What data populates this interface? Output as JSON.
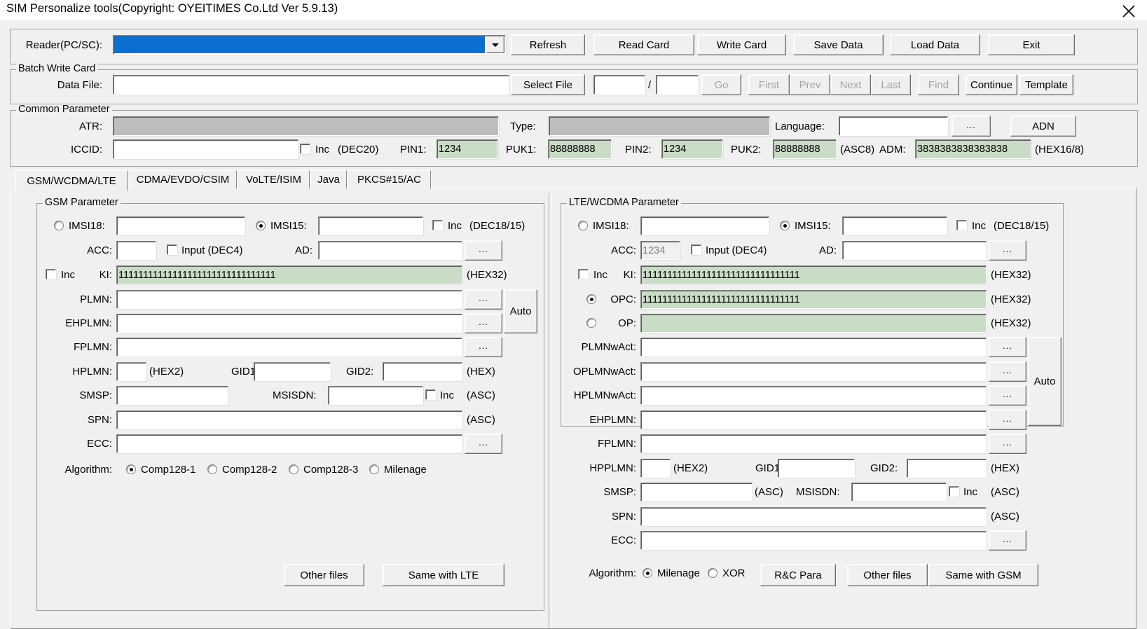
{
  "window": {
    "title": "SIM Personalize tools(Copyright: OYEITIMES Co.Ltd  Ver 5.9.13)",
    "close_icon": "close-icon"
  },
  "toolbar": {
    "reader_label": "Reader(PC/SC):",
    "reader_value": "",
    "buttons": [
      {
        "label": "Refresh"
      },
      {
        "label": "Read Card"
      },
      {
        "label": "Write Card"
      },
      {
        "label": "Save Data"
      },
      {
        "label": "Load Data"
      },
      {
        "label": "Exit"
      }
    ]
  },
  "batch": {
    "legend": "Batch Write Card",
    "data_file_label": "Data File:",
    "data_file_value": "",
    "select_file_label": "Select File",
    "index_value": "",
    "slash": "/",
    "total_value": "",
    "go_label": "Go",
    "first_label": "First",
    "prev_label": "Prev",
    "next_label": "Next",
    "last_label": "Last",
    "find_label": "Find",
    "continue_label": "Continue",
    "template_label": "Template"
  },
  "common": {
    "legend": "Common Parameter",
    "atr_label": "ATR:",
    "atr_value": "",
    "type_label": "Type:",
    "type_value": "",
    "language_label": "Language:",
    "language_value": "",
    "language_browse_label": "...",
    "adn_label": "ADN",
    "iccid_label": "ICCID:",
    "iccid_value": "",
    "iccid_inc_label": "Inc",
    "iccid_fmt": "(DEC20)",
    "pin1_label": "PIN1:",
    "pin1_value": "1234",
    "puk1_label": "PUK1:",
    "puk1_value": "88888888",
    "pin2_label": "PIN2:",
    "pin2_value": "1234",
    "puk2_label": "PUK2:",
    "puk2_value": "88888888",
    "asc8_fmt": "(ASC8)",
    "adm_label": "ADM:",
    "adm_value": "3838383838383838",
    "adm_fmt": "(HEX16/8)"
  },
  "tabs": [
    {
      "label": "GSM/WCDMA/LTE",
      "selected": true
    },
    {
      "label": "CDMA/EVDO/CSIM",
      "selected": false
    },
    {
      "label": "VoLTE/ISIM",
      "selected": false
    },
    {
      "label": "Java",
      "selected": false
    },
    {
      "label": "PKCS#15/AC",
      "selected": false
    }
  ],
  "gsm": {
    "legend": "GSM Parameter",
    "imsi18_label": "IMSI18:",
    "imsi18_value": "",
    "imsi15_label": "IMSI15:",
    "imsi15_value": "",
    "imsi_inc_label": "Inc",
    "imsi_fmt": "(DEC18/15)",
    "acc_label": "ACC:",
    "acc_value": "",
    "acc_input_label": "Input (DEC4)",
    "ad_label": "AD:",
    "ad_value": "",
    "ad_browse_label": "...",
    "ki_inc_label": "Inc",
    "ki_label": "KI:",
    "ki_value": "11111111111111111111111111111111",
    "ki_fmt": "(HEX32)",
    "plmn_label": "PLMN:",
    "plmn_value": "",
    "plmn_browse_label": "...",
    "ehplmn_label": "EHPLMN:",
    "ehplmn_value": "",
    "ehplmn_browse_label": "...",
    "auto_label": "Auto",
    "fplmn_label": "FPLMN:",
    "fplmn_value": "",
    "fplmn_browse_label": "...",
    "hplmn_label": "HPLMN:",
    "hplmn_value": "",
    "hplmn_fmt": "(HEX2)",
    "gid1_label": "GID1:",
    "gid1_value": "",
    "gid2_label": "GID2:",
    "gid2_value": "",
    "gid_fmt": "(HEX)",
    "smsp_label": "SMSP:",
    "smsp_value": "",
    "msisdn_label": "MSISDN:",
    "msisdn_value": "",
    "msisdn_inc_label": "Inc",
    "msisdn_fmt": "(ASC)",
    "spn_label": "SPN:",
    "spn_value": "",
    "spn_fmt": "(ASC)",
    "ecc_label": "ECC:",
    "ecc_value": "",
    "ecc_browse_label": "...",
    "algorithm_label": "Algorithm:",
    "algorithms": [
      {
        "label": "Comp128-1",
        "selected": true
      },
      {
        "label": "Comp128-2",
        "selected": false
      },
      {
        "label": "Comp128-3",
        "selected": false
      },
      {
        "label": "Milenage",
        "selected": false
      }
    ],
    "other_files_label": "Other files",
    "same_with_lte_label": "Same with LTE"
  },
  "lte": {
    "legend": "LTE/WCDMA Parameter",
    "imsi18_label": "IMSI18:",
    "imsi18_value": "",
    "imsi15_label": "IMSI15:",
    "imsi15_value": "",
    "imsi_inc_label": "Inc",
    "imsi_fmt": "(DEC18/15)",
    "acc_label": "ACC:",
    "acc_value": "1234",
    "acc_input_label": "Input (DEC4)",
    "ad_label": "AD:",
    "ad_value": "",
    "ad_browse_label": "...",
    "ki_inc_label": "Inc",
    "ki_label": "KI:",
    "ki_value": "11111111111111111111111111111111",
    "ki_fmt": "(HEX32)",
    "opc_label": "OPC:",
    "opc_value": "11111111111111111111111111111111",
    "opc_fmt": "(HEX32)",
    "op_label": "OP:",
    "op_value": "",
    "op_fmt": "(HEX32)",
    "plmnwact_label": "PLMNwAct:",
    "plmnwact_value": "",
    "oplmnwact_label": "OPLMNwAct:",
    "oplmnwact_value": "",
    "hplmnwact_label": "HPLMNwAct:",
    "hplmnwact_value": "",
    "ehplmn_label": "EHPLMN:",
    "ehplmn_value": "",
    "fplmn_label": "FPLMN:",
    "fplmn_value": "",
    "browse_label": "...",
    "auto_label": "Auto",
    "hpplmn_label": "HPPLMN:",
    "hpplmn_value": "",
    "hpplmn_fmt": "(HEX2)",
    "gid1_label": "GID1:",
    "gid1_value": "",
    "gid2_label": "GID2:",
    "gid2_value": "",
    "gid_fmt": "(HEX)",
    "smsp_label": "SMSP:",
    "smsp_value": "",
    "smsp_fmt": "(ASC)",
    "msisdn_label": "MSISDN:",
    "msisdn_value": "",
    "msisdn_inc_label": "Inc",
    "msisdn_fmt": "(ASC)",
    "spn_label": "SPN:",
    "spn_value": "",
    "spn_fmt": "(ASC)",
    "ecc_label": "ECC:",
    "ecc_value": "",
    "ecc_browse_label": "...",
    "algorithm_label": "Algorithm:",
    "algorithms": [
      {
        "label": "Milenage",
        "selected": true
      },
      {
        "label": "XOR",
        "selected": false
      }
    ],
    "rc_para_label": "R&C Para",
    "other_files_label": "Other files",
    "same_with_gsm_label": "Same with GSM"
  }
}
